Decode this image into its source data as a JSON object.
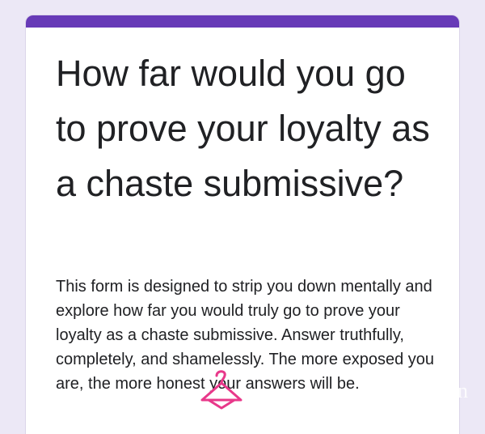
{
  "form": {
    "title": "How far would you go to prove your loyalty as a chaste submissive?",
    "description": "This form is designed to strip you down mentally and explore how far you would truly go to prove your loyalty as a chaste submissive. Answer truthfully, completely, and shamelessly. The more exposed you are, the more honest your answers will be."
  },
  "colors": {
    "accent": "#673ab7",
    "background": "#ece8f6",
    "card": "#ffffff",
    "text": "#202124",
    "watermark": "#e8388a"
  },
  "watermark": {
    "icon": "hanger-logo-icon",
    "text": "n"
  }
}
